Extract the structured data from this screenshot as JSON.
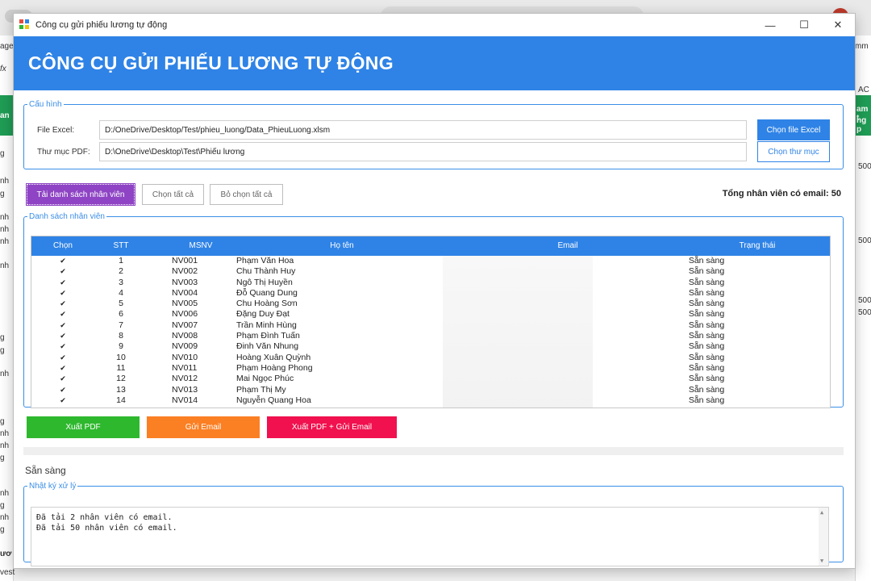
{
  "window": {
    "title": "Công cụ gửi phiếu lương tự động",
    "minimize": "—",
    "maximize": "☐",
    "close": "✕"
  },
  "header": {
    "title": "CÔNG CỤ GỬI PHIẾU LƯƠNG TỰ ĐỘNG"
  },
  "config": {
    "legend": "Cấu hình",
    "excel_label": "File Excel:",
    "excel_value": "D:/OneDrive/Desktop/Test/phieu_luong/Data_PhieuLuong.xlsm",
    "excel_button": "Chọn file Excel",
    "pdf_label": "Thư mục PDF:",
    "pdf_value": "D:\\OneDrive\\Desktop\\Test\\Phiếu lương",
    "pdf_button": "Chọn thư mục"
  },
  "actions": {
    "load": "Tải danh sách nhân viên",
    "select_all": "Chọn tất cả",
    "deselect_all": "Bỏ chọn tất cả",
    "total": "Tổng nhân viên có email: 50"
  },
  "list": {
    "legend": "Danh sách nhân viên",
    "columns": [
      "Chọn",
      "STT",
      "MSNV",
      "Họ tên",
      "Email",
      "Trạng thái"
    ],
    "rows": [
      {
        "chk": "✔",
        "stt": "1",
        "msnv": "NV001",
        "name": "Phạm Văn Hoa",
        "status": "Sẵn sàng"
      },
      {
        "chk": "✔",
        "stt": "2",
        "msnv": "NV002",
        "name": "Chu Thành Huy",
        "status": "Sẵn sàng"
      },
      {
        "chk": "✔",
        "stt": "3",
        "msnv": "NV003",
        "name": "Ngô Thị Huyền",
        "status": "Sẵn sàng"
      },
      {
        "chk": "✔",
        "stt": "4",
        "msnv": "NV004",
        "name": "Đỗ Quang Dung",
        "status": "Sẵn sàng"
      },
      {
        "chk": "✔",
        "stt": "5",
        "msnv": "NV005",
        "name": "Chu Hoàng Sơn",
        "status": "Sẵn sàng"
      },
      {
        "chk": "✔",
        "stt": "6",
        "msnv": "NV006",
        "name": "Đặng Duy Đạt",
        "status": "Sẵn sàng"
      },
      {
        "chk": "✔",
        "stt": "7",
        "msnv": "NV007",
        "name": "Trần Minh Hùng",
        "status": "Sẵn sàng"
      },
      {
        "chk": "✔",
        "stt": "8",
        "msnv": "NV008",
        "name": "Phạm Đình Tuấn",
        "status": "Sẵn sàng"
      },
      {
        "chk": "✔",
        "stt": "9",
        "msnv": "NV009",
        "name": "Đinh Văn Nhung",
        "status": "Sẵn sàng"
      },
      {
        "chk": "✔",
        "stt": "10",
        "msnv": "NV010",
        "name": "Hoàng Xuân Quỳnh",
        "status": "Sẵn sàng"
      },
      {
        "chk": "✔",
        "stt": "11",
        "msnv": "NV011",
        "name": "Phạm Hoàng Phong",
        "status": "Sẵn sàng"
      },
      {
        "chk": "✔",
        "stt": "12",
        "msnv": "NV012",
        "name": "Mai Ngọc Phúc",
        "status": "Sẵn sàng"
      },
      {
        "chk": "✔",
        "stt": "13",
        "msnv": "NV013",
        "name": "Phạm Thị My",
        "status": "Sẵn sàng"
      },
      {
        "chk": "✔",
        "stt": "14",
        "msnv": "NV014",
        "name": "Nguyễn Quang Hoa",
        "status": "Sẵn sàng"
      }
    ]
  },
  "buttons": {
    "export_pdf": "Xuất PDF",
    "send_email": "Gửi Email",
    "export_and_send": "Xuất PDF + Gửi Email"
  },
  "status": "Sẵn sàng",
  "log": {
    "legend": "Nhật ký xử lý",
    "lines": [
      "Đã tải 2 nhân viên có email.",
      "Đã tải 50 nhân viên có email."
    ]
  },
  "background": {
    "left_cells": [
      "age",
      "fx",
      "an",
      "g",
      "nh",
      "g",
      "nh",
      "nh",
      "nh",
      "nh",
      "g",
      "g",
      "nh",
      "g",
      "nh",
      "nh",
      "g",
      "nh",
      "g",
      "nh",
      "g",
      "ươ",
      "vest"
    ],
    "right_cells": [
      "mm",
      "AC",
      "am t",
      "ng p",
      "500",
      "500",
      "500",
      "500"
    ]
  },
  "colors": {
    "header_blue": "#2f83e6",
    "purple": "#8e44c4",
    "green": "#2eb82e",
    "orange": "#fb7f23",
    "red": "#f0114e"
  }
}
